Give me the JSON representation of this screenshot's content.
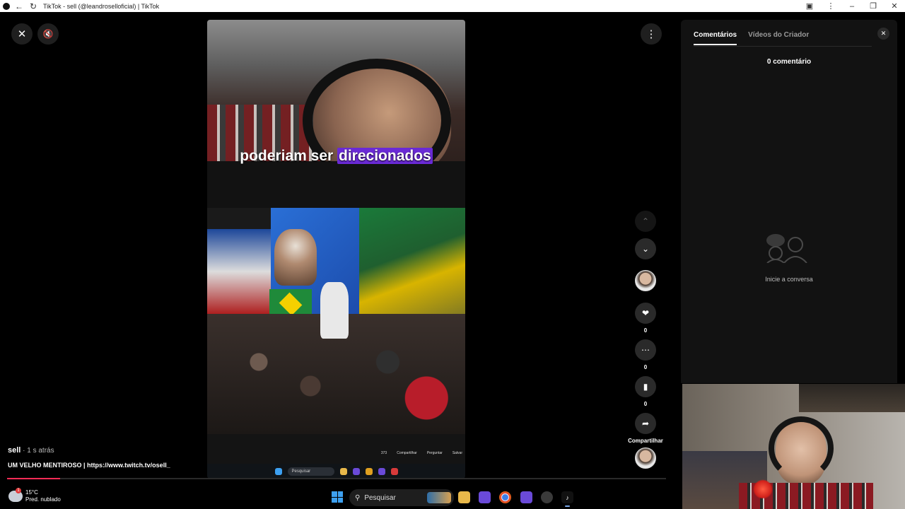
{
  "browser": {
    "title": "TikTok - sell (@leandroselloficial) | TikTok"
  },
  "video": {
    "caption_plain": "poderiam ser",
    "caption_highlight": "direcionados",
    "ui_likes": "373",
    "ui_share": "Compartilhar",
    "ui_ask": "Perguntar",
    "ui_save": "Salvar",
    "taskbar_search": "Pesquisar"
  },
  "actions": {
    "like_count": "0",
    "comment_count": "0",
    "save_count": "0",
    "share_label": "Compartilhar"
  },
  "post": {
    "author": "sell",
    "time": " · 1 s atrás",
    "description": "UM VELHO MENTIROSO | https://www.twitch.tv/osell_",
    "progress": 0.08
  },
  "comments_panel": {
    "tabs": [
      "Comentários",
      "Vídeos do Criador"
    ],
    "active_tab": 0,
    "count_label": "0 comentário",
    "empty_label": "Inicie a conversa"
  },
  "taskbar": {
    "weather_temp": "15°C",
    "weather_desc": "Pred. nublado",
    "weather_badge": "1",
    "search_label": "Pesquisar"
  },
  "colors": {
    "accent": "#fe2c55",
    "caption_highlight": "#6a2ad6",
    "panel_bg": "#121212"
  }
}
